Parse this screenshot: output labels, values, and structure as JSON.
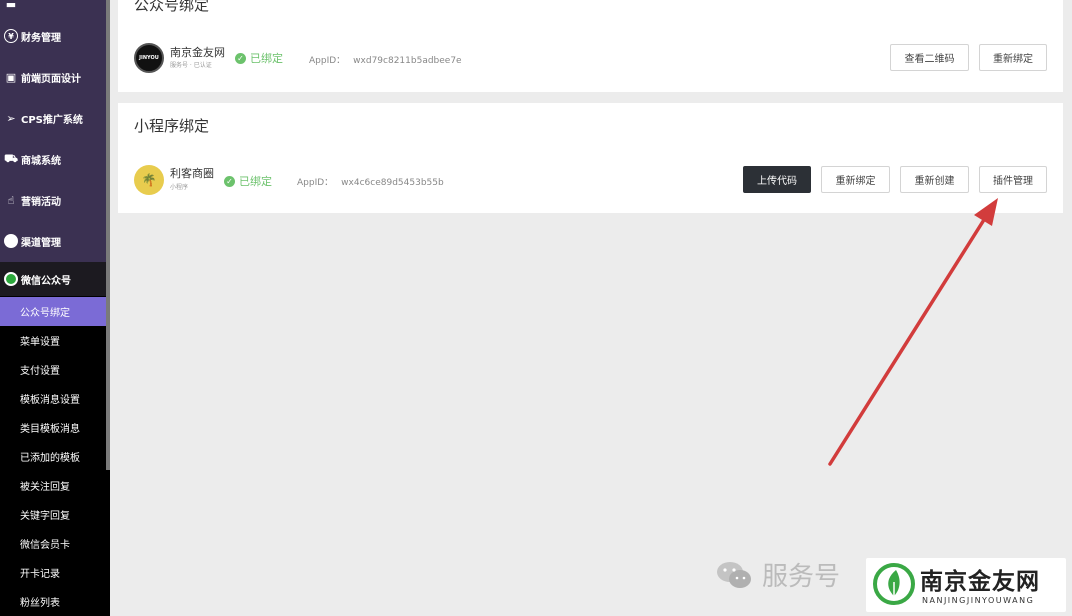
{
  "sidebar": {
    "items": [
      {
        "label": "财务管理",
        "icon": "yen-icon"
      },
      {
        "label": "前端页面设计",
        "icon": "layout-icon"
      },
      {
        "label": "CPS推广系统",
        "icon": "send-icon"
      },
      {
        "label": "商城系统",
        "icon": "cart-icon"
      },
      {
        "label": "营销活动",
        "icon": "hand-icon"
      },
      {
        "label": "渠道管理",
        "icon": "dot-icon"
      }
    ],
    "wechat": {
      "label": "微信公众号",
      "icon": "wechat-icon"
    },
    "sub_items": [
      {
        "label": "公众号绑定",
        "active": true
      },
      {
        "label": "菜单设置"
      },
      {
        "label": "支付设置"
      },
      {
        "label": "模板消息设置"
      },
      {
        "label": "类目模板消息"
      },
      {
        "label": "已添加的模板"
      },
      {
        "label": "被关注回复"
      },
      {
        "label": "关键字回复"
      },
      {
        "label": "微信会员卡"
      },
      {
        "label": "开卡记录"
      },
      {
        "label": "粉丝列表"
      }
    ]
  },
  "official_account": {
    "title": "公众号绑定",
    "name": "南京金友网",
    "sub": "服务号 · 已认证",
    "status": "已绑定",
    "appid_label": "AppID：",
    "appid": "wxd79c8211b5adbee7e",
    "btn_qrcode": "查看二维码",
    "btn_rebind": "重新绑定"
  },
  "mini_program": {
    "title": "小程序绑定",
    "name": "利客商圈",
    "sub": "小程序",
    "status": "已绑定",
    "appid_label": "AppID：",
    "appid": "wx4c6ce89d5453b55b",
    "btn_upload": "上传代码",
    "btn_rebind": "重新绑定",
    "btn_recreate": "重新创建",
    "btn_plugin": "插件管理"
  },
  "watermark": {
    "gray_text": "服务号",
    "cn": "南京金友网",
    "en": "NANJINGJINYOUWANG"
  },
  "colors": {
    "sidebar_top": "#3b3152",
    "active_item": "#7b6bd6",
    "bound_green": "#6cc26c",
    "arrow": "#d23c3c"
  }
}
